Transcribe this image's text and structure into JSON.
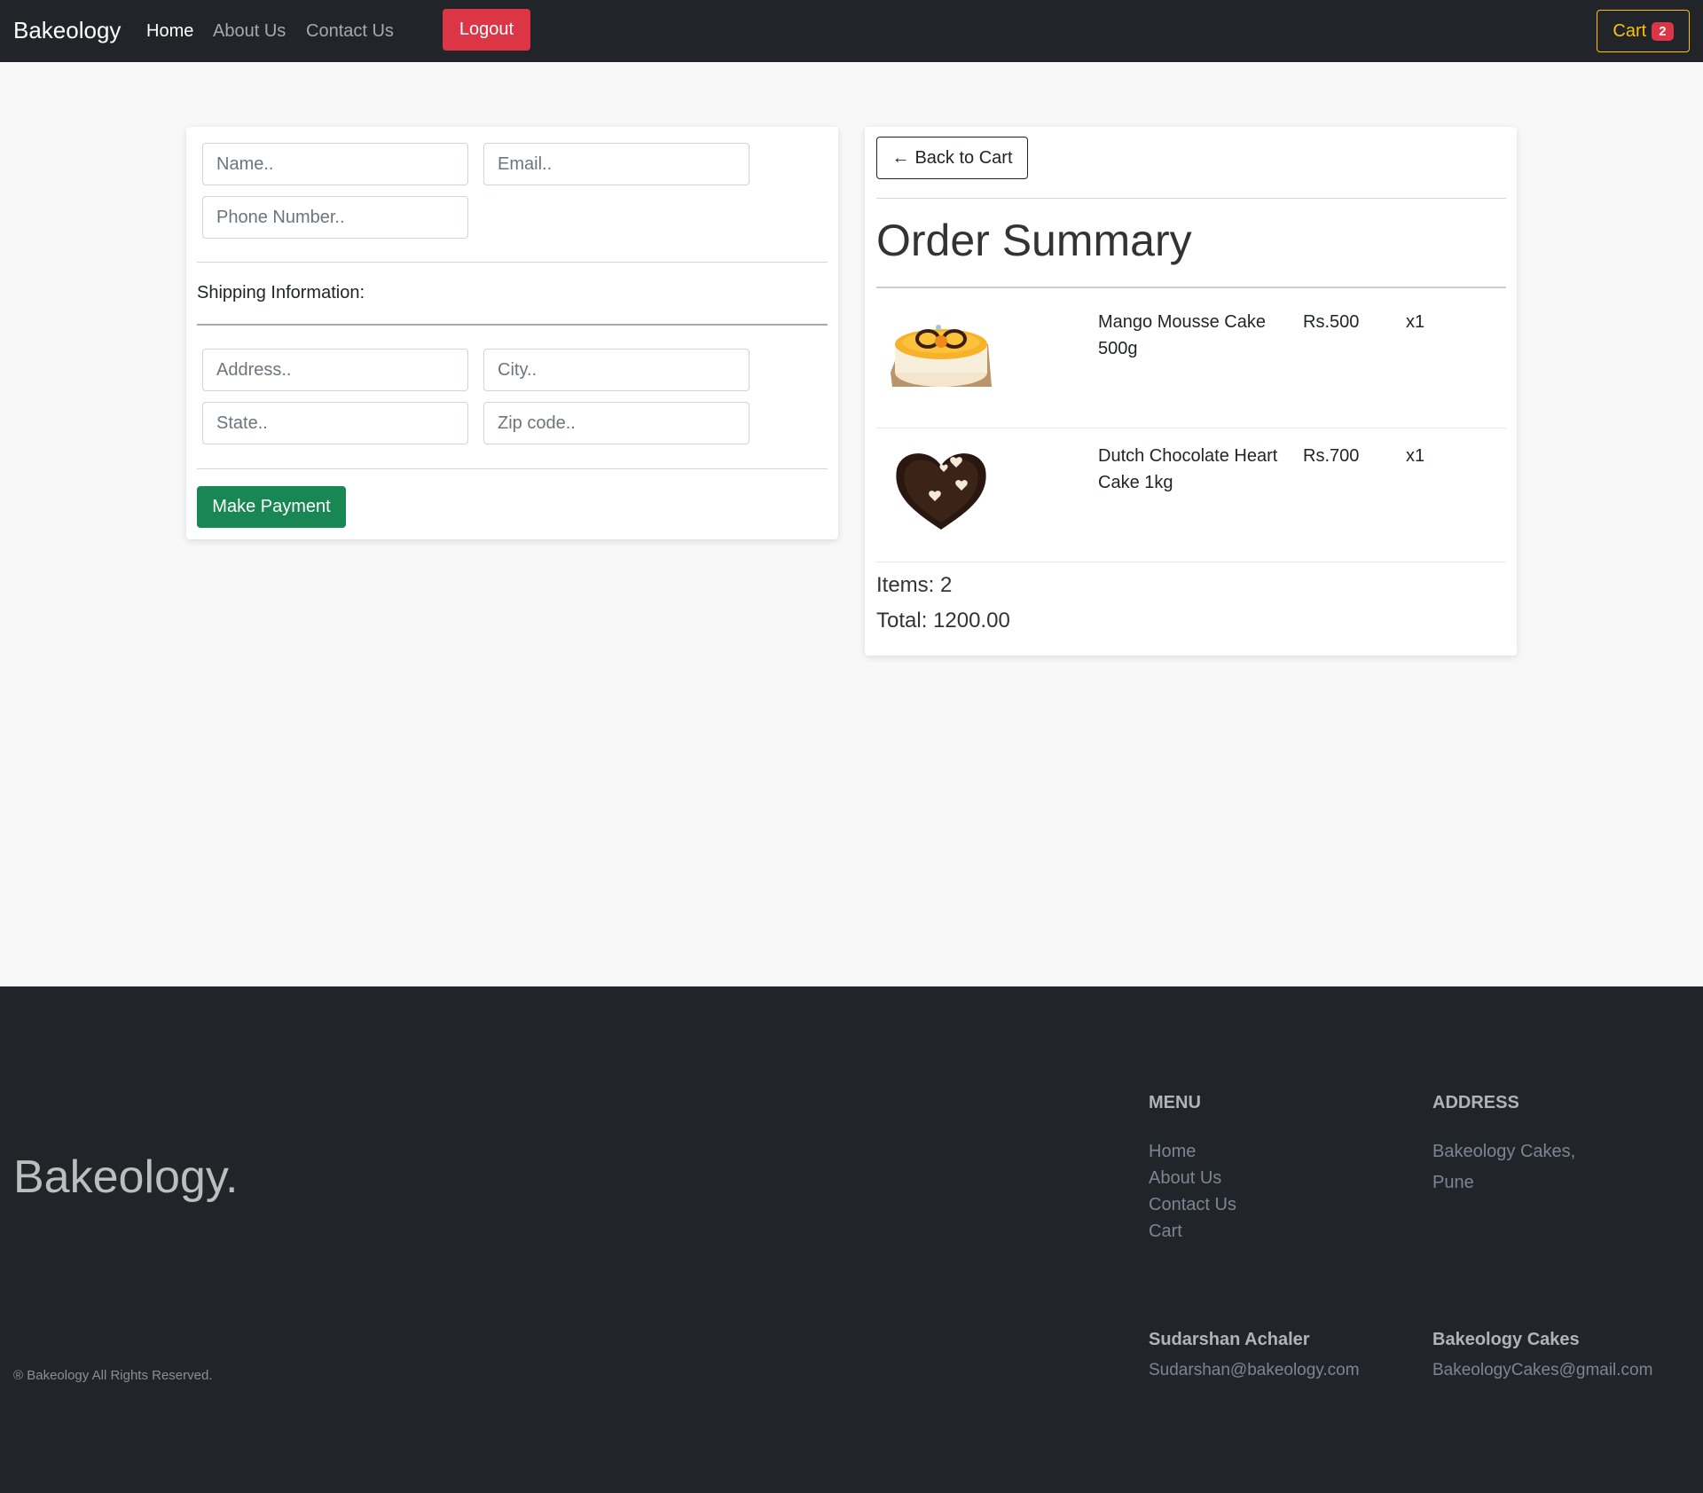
{
  "navbar": {
    "brand": "Bakeology",
    "links": [
      "Home",
      "About Us",
      "Contact Us"
    ],
    "logout_label": "Logout",
    "cart_label": "Cart",
    "cart_count": "2"
  },
  "form": {
    "name_placeholder": "Name..",
    "email_placeholder": "Email..",
    "phone_placeholder": "Phone Number..",
    "shipping_label": "Shipping Information:",
    "address_placeholder": "Address..",
    "city_placeholder": "City..",
    "state_placeholder": "State..",
    "zip_placeholder": "Zip code..",
    "pay_label": "Make Payment"
  },
  "summary": {
    "back_label": "Back to Cart",
    "back_arrow": "←",
    "title": "Order Summary",
    "items": [
      {
        "name": "Mango Mousse Cake 500g",
        "price": "Rs.500",
        "qty": "x1",
        "image": "mango-mousse-cake"
      },
      {
        "name": "Dutch Chocolate Heart Cake 1kg",
        "price": "Rs.700",
        "qty": "x1",
        "image": "chocolate-heart-cake"
      }
    ],
    "items_text": "Items: 2",
    "total_text": "Total: 1200.00"
  },
  "footer": {
    "logo": "Bakeology.",
    "copyright": "® Bakeology All Rights Reserved.",
    "menu_heading": "MENU",
    "menu_links": [
      "Home",
      "About Us",
      "Contact Us",
      "Cart"
    ],
    "address_heading": "ADDRESS",
    "address_lines": [
      "Bakeology Cakes,",
      "Pune"
    ],
    "contacts": [
      {
        "name": "Sudarshan Achaler",
        "email": "Sudarshan@bakeology.com"
      },
      {
        "name": "Bakeology Cakes",
        "email": "BakeologyCakes@gmail.com"
      }
    ]
  },
  "colors": {
    "navbar_bg": "#212529",
    "logout": "#dc3545",
    "cart_accent": "#ffc107",
    "pay_button": "#198754"
  }
}
